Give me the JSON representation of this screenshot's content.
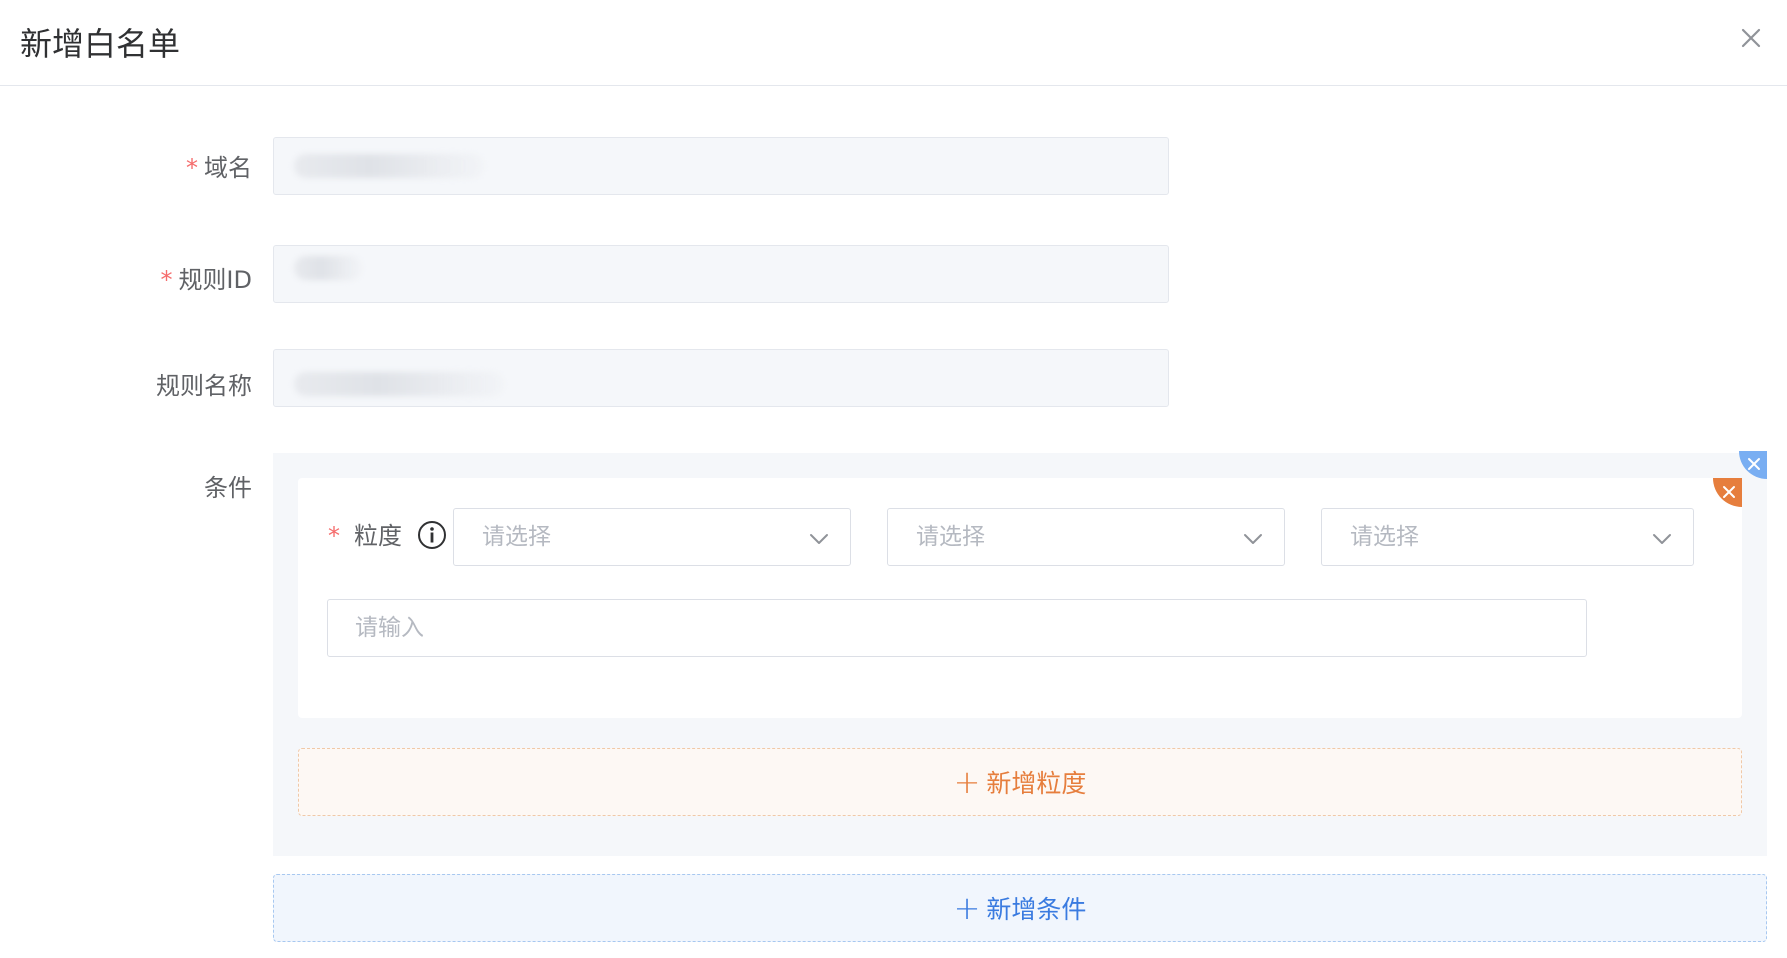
{
  "dialog": {
    "title": "新增白名单"
  },
  "form": {
    "domain": {
      "label": "域名",
      "required": true
    },
    "rule_id": {
      "label": "规则ID",
      "required": true
    },
    "rule_name": {
      "label": "规则名称",
      "required": false
    },
    "conditions_label": "条件"
  },
  "condition": {
    "granularity_label": "粒度",
    "selects": [
      {
        "placeholder": "请选择"
      },
      {
        "placeholder": "请选择"
      },
      {
        "placeholder": "请选择"
      }
    ],
    "input_placeholder": "请输入",
    "add_granularity_label": "新增粒度"
  },
  "add_condition_label": "新增条件",
  "colors": {
    "required": "#f56c6c",
    "orange_accent": "#e67e3d",
    "blue_accent": "#3a7be0",
    "readonly_bg": "#f5f7fa"
  },
  "icons": {
    "close": "close-icon",
    "info": "info-icon",
    "chevron": "chevron-down-icon",
    "plus": "plus-icon"
  }
}
